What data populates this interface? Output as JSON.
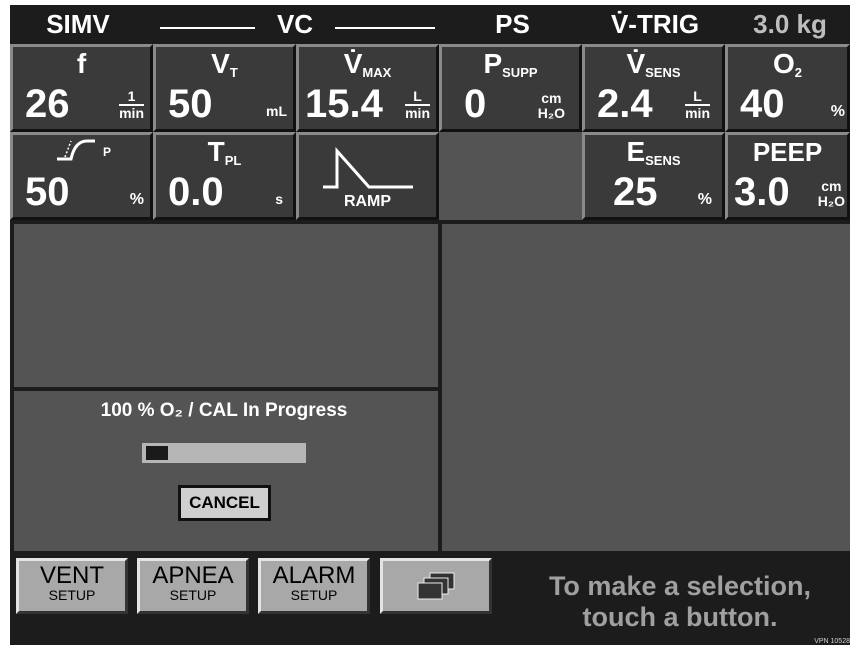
{
  "header": {
    "mode": "SIMV",
    "mandatory_type": "VC",
    "spont_type": "PS",
    "trigger": "V̇-TRIG",
    "weight": "3.0 kg"
  },
  "settings_row1": [
    {
      "label": "f",
      "label_sub": "",
      "value": "26",
      "unit_num": "1",
      "unit_den": "min"
    },
    {
      "label": "V",
      "label_sub": "T",
      "value": "50",
      "unit": "mL"
    },
    {
      "label": "V̇",
      "label_sub": "MAX",
      "value": "15.4",
      "unit_num": "L",
      "unit_den": "min"
    },
    {
      "label": "P",
      "label_sub": "SUPP",
      "value": "0",
      "unit_num": "cm",
      "unit_den": "H₂O"
    },
    {
      "label": "V̇",
      "label_sub": "SENS",
      "value": "2.4",
      "unit_num": "L",
      "unit_den": "min"
    },
    {
      "label": "O",
      "label_sub": "2",
      "value": "40",
      "unit": "%"
    }
  ],
  "settings_row2": [
    {
      "label": "P",
      "value": "50",
      "unit": "%"
    },
    {
      "label": "T",
      "label_sub": "PL",
      "value": "0.0",
      "unit": "s"
    },
    {
      "label": "RAMP"
    },
    {
      "label": "E",
      "label_sub": "SENS",
      "value": "25",
      "unit": "%"
    },
    {
      "label": "PEEP",
      "value": "3.0",
      "unit_num": "cm",
      "unit_den": "H₂O"
    }
  ],
  "progress": {
    "title": "100 % O₂ / CAL In Progress",
    "fraction": 0.14,
    "cancel_label": "CANCEL"
  },
  "bottom": {
    "vent_big": "VENT",
    "vent_small": "SETUP",
    "apnea_big": "APNEA",
    "apnea_small": "SETUP",
    "alarm_big": "ALARM",
    "alarm_small": "SETUP",
    "prompt_line1": "To make a selection,",
    "prompt_line2": "touch a button.",
    "doc_code": "VPN 10528"
  },
  "colors": {
    "screen_bg": "#1c1c1c",
    "panel_bg": "#545454",
    "button_bg": "#3a3a3a",
    "bottom_button_bg": "#a8a8a8"
  }
}
